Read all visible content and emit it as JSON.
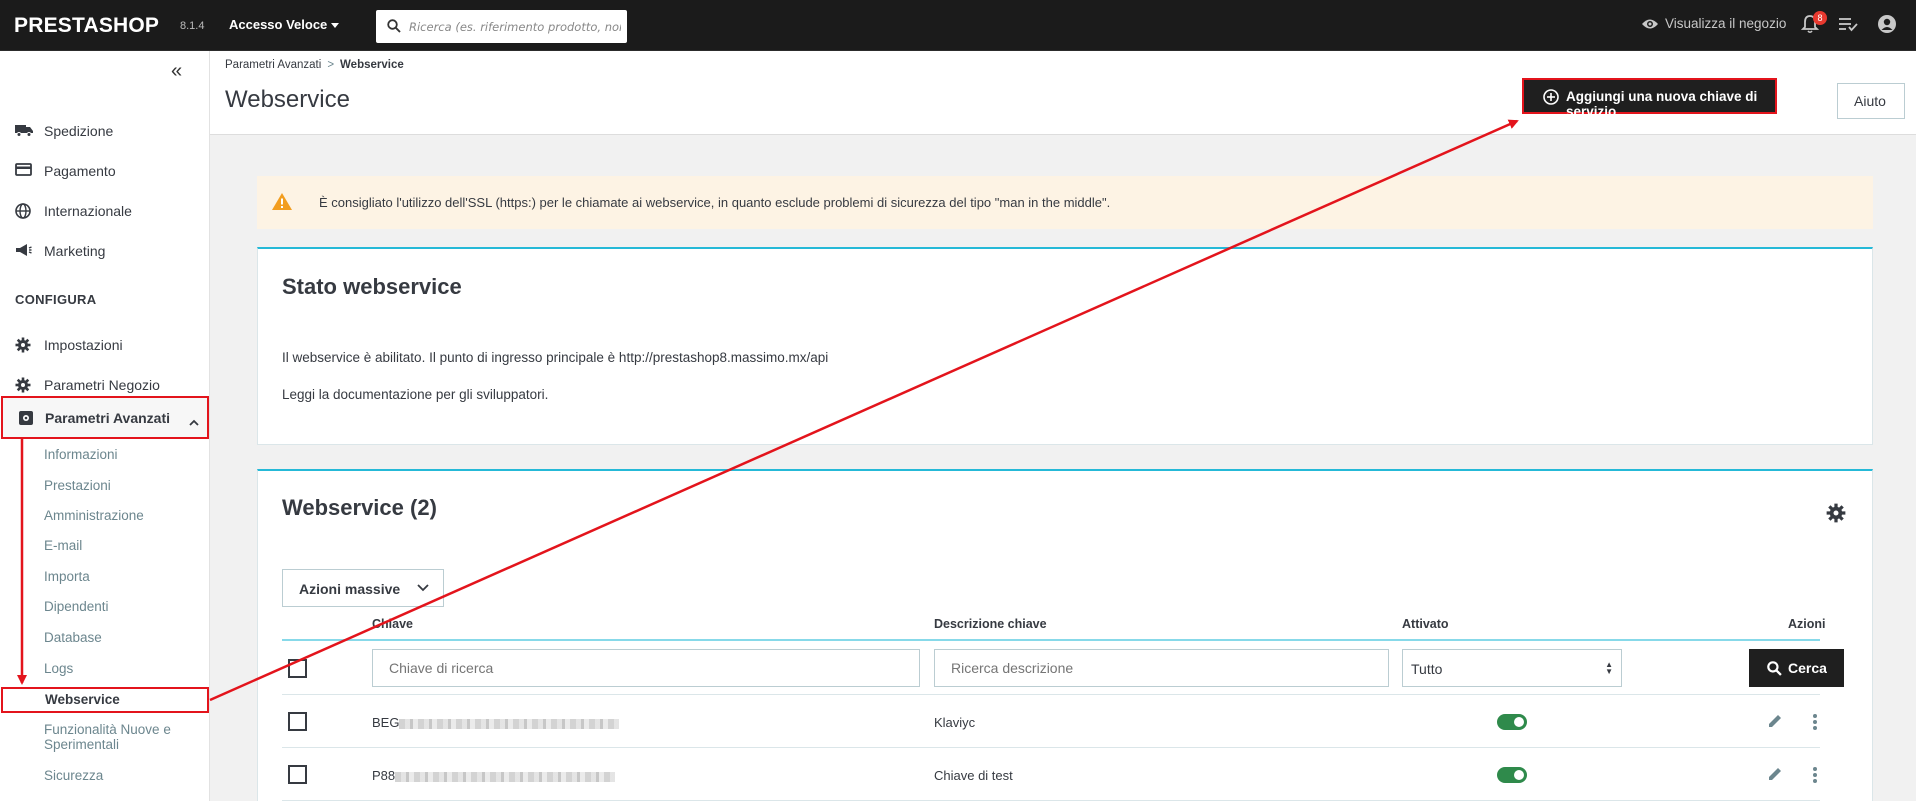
{
  "topbar": {
    "logo": "PRESTASHOP",
    "version": "8.1.4",
    "quick_access": "Accesso Veloce",
    "search_placeholder": "Ricerca (es. riferimento prodotto, nom",
    "view_shop": "Visualizza il negozio",
    "notif_count": "8"
  },
  "sidebar": {
    "items_top": [
      {
        "label": "Spedizione",
        "icon": "truck-icon"
      },
      {
        "label": "Pagamento",
        "icon": "credit-card-icon"
      },
      {
        "label": "Internazionale",
        "icon": "globe-icon"
      },
      {
        "label": "Marketing",
        "icon": "megaphone-icon"
      }
    ],
    "section": "CONFIGURA",
    "items_config": [
      {
        "label": "Impostazioni",
        "icon": "gear-icon"
      },
      {
        "label": "Parametri Negozio",
        "icon": "gear-icon"
      }
    ],
    "active_parent": "Parametri Avanzati",
    "sub_items": [
      "Informazioni",
      "Prestazioni",
      "Amministrazione",
      "E-mail",
      "Importa",
      "Dipendenti",
      "Database",
      "Logs"
    ],
    "active_sub": "Webservice",
    "sub_items_after": [
      "Funzionalità Nuove e",
      "Sperimentali",
      "Sicurezza"
    ]
  },
  "header": {
    "breadcrumb_parent": "Parametri Avanzati",
    "breadcrumb_sep": ">",
    "breadcrumb_current": "Webservice",
    "title": "Webservice",
    "add_button": "Aggiungi una nuova chiave di servizio",
    "help_button": "Aiuto"
  },
  "alert": {
    "text": "È consigliato l'utilizzo dell'SSL (https:) per le chiamate ai webservice, in quanto esclude problemi di sicurezza del tipo \"man in the middle\"."
  },
  "status_panel": {
    "title": "Stato webservice",
    "line1": "Il webservice è abilitato. Il punto di ingresso principale è http://prestashop8.massimo.mx/api",
    "line2": "Leggi la documentazione per gli sviluppatori."
  },
  "list_panel": {
    "title": "Webservice (2)",
    "bulk_actions": "Azioni massive",
    "columns": {
      "key": "Chiave",
      "description": "Descrizione chiave",
      "active": "Attivato",
      "actions": "Azioni"
    },
    "filters": {
      "key_placeholder": "Chiave di ricerca",
      "desc_placeholder": "Ricerca descrizione",
      "active_value": "Tutto",
      "search_button": "Cerca"
    },
    "rows": [
      {
        "key_prefix": "BEG",
        "description": "Klaviyc",
        "active": true
      },
      {
        "key_prefix": "P88",
        "description": "Chiave di test",
        "active": true
      }
    ]
  },
  "colors": {
    "annotation": "#e3141c",
    "accent": "#25b9d7",
    "toggle_on": "#2f8a4b"
  }
}
